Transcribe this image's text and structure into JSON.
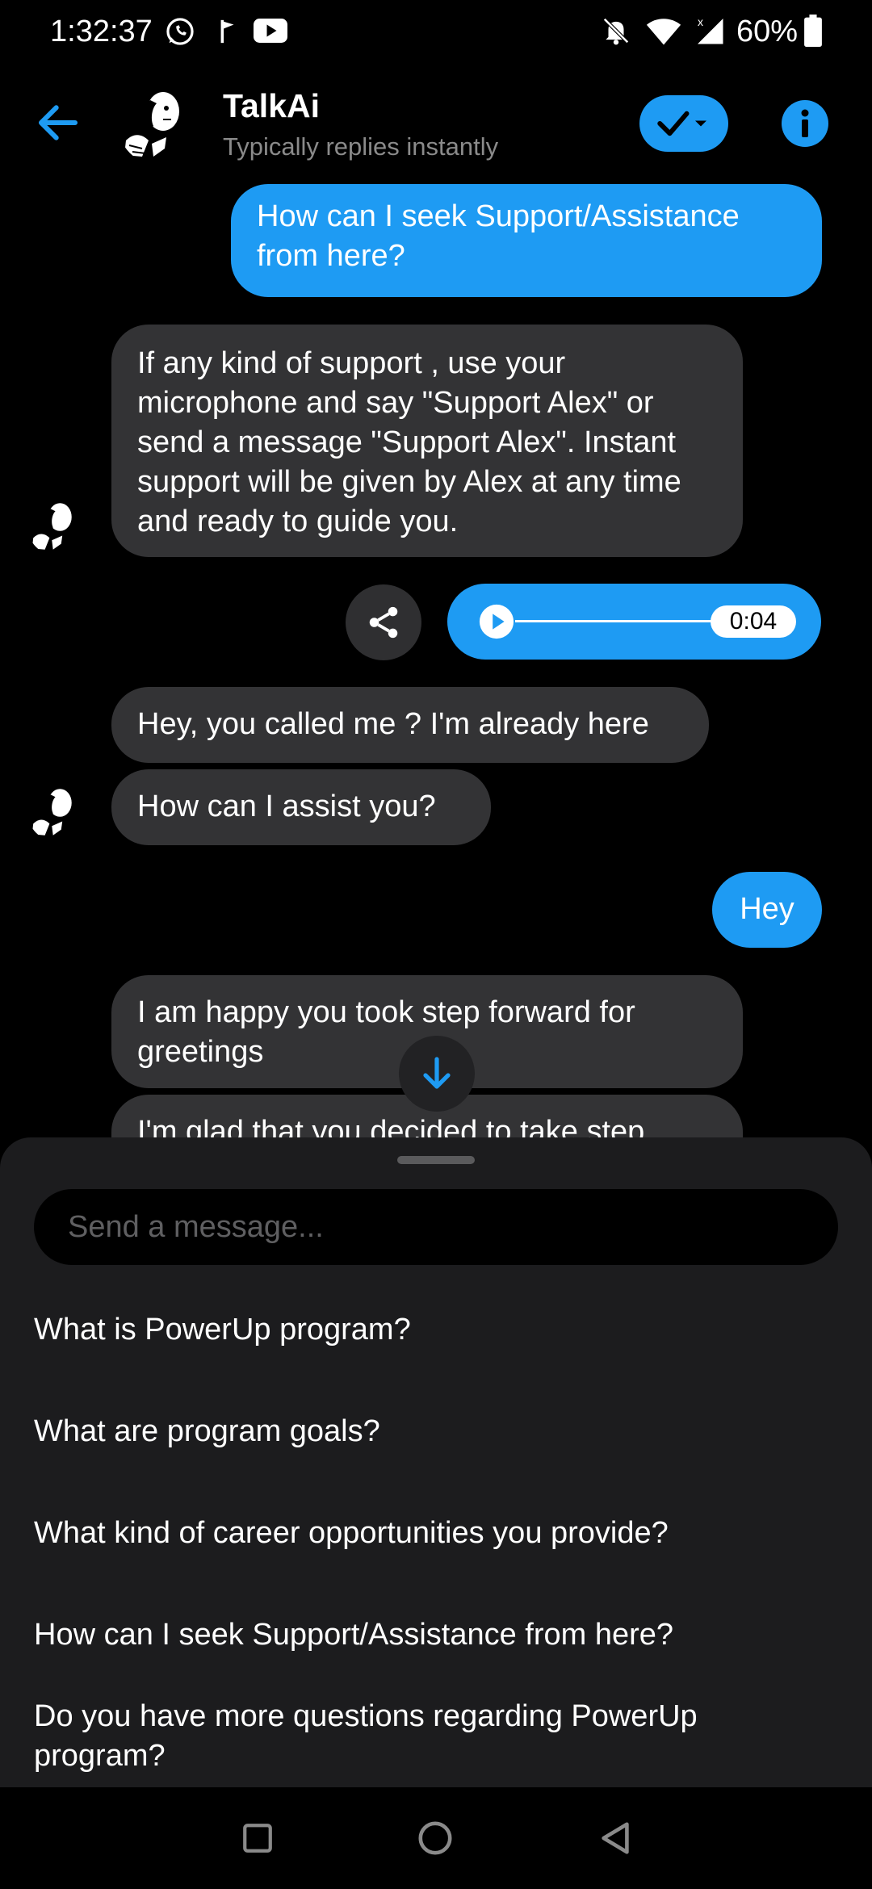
{
  "status_bar": {
    "time": "1:32:37",
    "battery": "60%",
    "icons": [
      "whatsapp-icon",
      "flag-icon",
      "youtube-icon",
      "bell-muted-icon",
      "wifi-icon",
      "signal-icon",
      "battery-icon"
    ]
  },
  "header": {
    "title": "TalkAi",
    "subtitle": "Typically replies instantly",
    "accent": "#1e9bf3"
  },
  "messages": {
    "m1": "How can I seek Support/Assistance from here?",
    "m2": "If any kind of support , use your microphone and say \"Support Alex\" or send a message \"Support Alex\". Instant support will be given by Alex at any time and ready to guide you.",
    "audio_duration": "0:04",
    "audio_progress": 0,
    "m3": "Hey, you called me ? I'm already here",
    "m4": "How can I assist you?",
    "m5": "Hey",
    "m6": "I am happy you took step forward for greetings",
    "m7": "I'm glad that you decided to take step"
  },
  "composer": {
    "placeholder": "Send a message..."
  },
  "suggestions": [
    "What is PowerUp program?",
    "What are program goals?",
    "What kind of career opportunities you provide?",
    "How can I seek Support/Assistance from here?",
    "Do you have more questions regarding PowerUp program?"
  ]
}
